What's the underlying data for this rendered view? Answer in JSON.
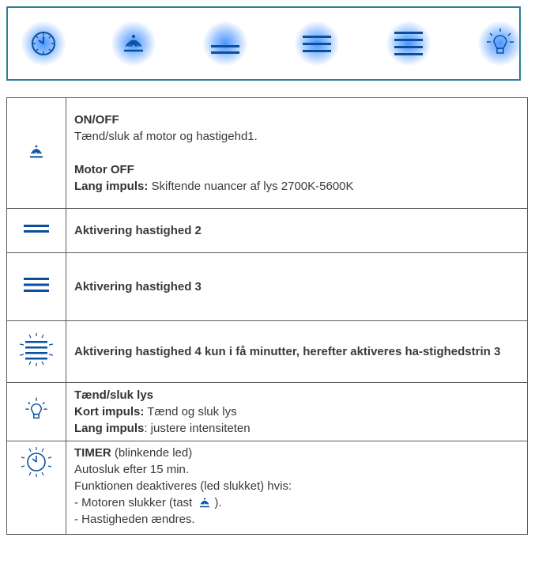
{
  "colors": {
    "accent": "#0a4f9e",
    "glow": "#2882ff",
    "panel_border": "#2f7d96",
    "text": "#3a3a3a"
  },
  "panel": {
    "buttons": [
      {
        "icon": "timer-icon"
      },
      {
        "icon": "fan-power-icon"
      },
      {
        "icon": "speed-2-icon"
      },
      {
        "icon": "speed-3-icon"
      },
      {
        "icon": "speed-4-icon"
      },
      {
        "icon": "light-bulb-icon"
      }
    ]
  },
  "rows": {
    "onoff": {
      "title": "ON/OFF",
      "desc": "Tænd/sluk af motor og hastigehd1.",
      "motor_off": "Motor OFF",
      "long_label": "Lang impuls:",
      "long_text": " Skiftende nuancer af lys 2700K-5600K"
    },
    "speed2": {
      "text": "Aktivering hastighed 2"
    },
    "speed3": {
      "text": "Aktivering hastighed 3"
    },
    "speed4": {
      "text": "Aktivering hastighed 4 kun i få minutter, herefter aktiveres ha-stighedstrin 3"
    },
    "light": {
      "title": "Tænd/sluk lys",
      "short_label": "Kort impuls:",
      "short_text": " Tænd og sluk lys",
      "long_label": "Lang impuls",
      "long_text": ": justere intensiteten"
    },
    "timer": {
      "title": "TIMER",
      "title_suffix": " (blinkende led)",
      "line1": "Autosluk efter 15 min.",
      "line2": "Funktionen deaktiveres (led slukket) hvis:",
      "line3_pre": "- Motoren slukker (tast ",
      "line3_post": ").",
      "line4": "- Hastigheden ændres."
    }
  }
}
